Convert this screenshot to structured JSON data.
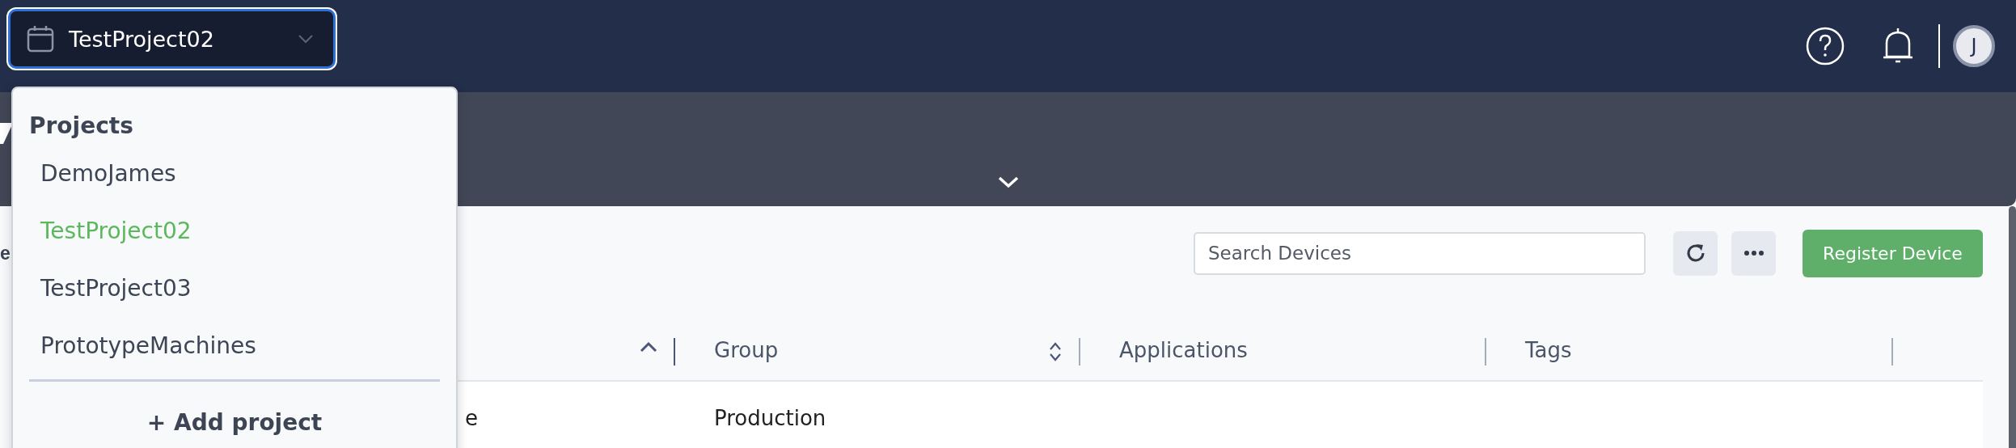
{
  "topbar": {
    "project_selector": {
      "value": "TestProject02",
      "expanded": true
    },
    "avatar": {
      "initial": "J"
    }
  },
  "banner": {
    "expanded": false
  },
  "page_title": "e",
  "toolbar": {
    "search": {
      "placeholder": "Search Devices"
    },
    "register_button": "Register Device"
  },
  "table": {
    "columns": [
      {
        "kind": "sorted_ascending"
      },
      {
        "label": "Group",
        "kind": "sortable"
      },
      {
        "label": "Applications",
        "kind": "plain"
      },
      {
        "label": "Tags",
        "kind": "plain"
      }
    ],
    "rows": [
      {
        "column_1": "e",
        "group": "Production"
      }
    ]
  },
  "project_menu": {
    "heading": "Projects",
    "items": [
      {
        "label": "DemoJames",
        "selected": false
      },
      {
        "label": "TestProject02",
        "selected": true
      },
      {
        "label": "TestProject03",
        "selected": false
      },
      {
        "label": "PrototypeMachines",
        "selected": false
      }
    ],
    "add_button": "+ Add project"
  }
}
